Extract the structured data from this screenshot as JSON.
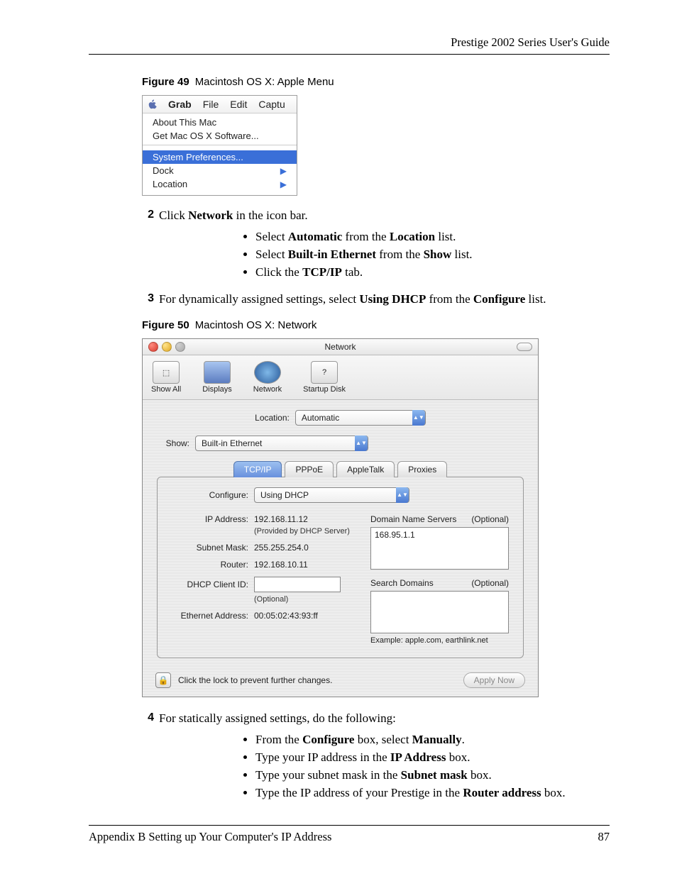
{
  "header": {
    "guide_title": "Prestige 2002 Series User's Guide"
  },
  "fig49": {
    "caption_num": "Figure 49",
    "caption_text": "Macintosh OS X: Apple Menu",
    "menubar": {
      "app": "Grab",
      "file": "File",
      "edit": "Edit",
      "capture": "Captu"
    },
    "items": {
      "about": "About This Mac",
      "software": "Get Mac OS X Software...",
      "sysprefs": "System Preferences...",
      "dock": "Dock",
      "location": "Location"
    }
  },
  "step2": {
    "num": "2",
    "text_a": "Click ",
    "text_b": "Network",
    "text_c": " in the icon bar.",
    "bullets": [
      {
        "pre": "Select ",
        "b1": "Automatic",
        "mid": " from the ",
        "b2": "Location",
        "post": " list."
      },
      {
        "pre": "Select ",
        "b1": "Built-in Ethernet",
        "mid": " from the ",
        "b2": "Show",
        "post": " list."
      },
      {
        "pre": "Click the ",
        "b1": "TCP/IP",
        "mid": "",
        "b2": "",
        "post": " tab."
      }
    ]
  },
  "step3": {
    "num": "3",
    "text_a": "For dynamically assigned settings, select ",
    "text_b": "Using DHCP",
    "text_c": " from the ",
    "text_d": "Configure",
    "text_e": " list."
  },
  "fig50": {
    "caption_num": "Figure 50",
    "caption_text": "Macintosh OS X: Network",
    "title": "Network",
    "toolbar": {
      "showall": "Show All",
      "displays": "Displays",
      "network": "Network",
      "startup": "Startup Disk"
    },
    "location_label": "Location:",
    "location_value": "Automatic",
    "show_label": "Show:",
    "show_value": "Built-in Ethernet",
    "tabs": {
      "tcpip": "TCP/IP",
      "pppoe": "PPPoE",
      "appletalk": "AppleTalk",
      "proxies": "Proxies"
    },
    "configure_label": "Configure:",
    "configure_value": "Using DHCP",
    "left": {
      "ip_label": "IP Address:",
      "ip_value": "192.168.11.12",
      "ip_note": "(Provided by DHCP Server)",
      "subnet_label": "Subnet Mask:",
      "subnet_value": "255.255.254.0",
      "router_label": "Router:",
      "router_value": "192.168.10.11",
      "dhcpid_label": "DHCP Client ID:",
      "dhcpid_note": "(Optional)",
      "eth_label": "Ethernet Address:",
      "eth_value": "00:05:02:43:93:ff"
    },
    "right": {
      "dns_label": "Domain Name Servers",
      "optional": "(Optional)",
      "dns_value": "168.95.1.1",
      "search_label": "Search Domains",
      "example": "Example: apple.com, earthlink.net"
    },
    "lock_text": "Click the lock to prevent further changes.",
    "apply": "Apply Now"
  },
  "step4": {
    "num": "4",
    "text": "For statically assigned settings, do the following:",
    "bullets": [
      {
        "pre": "From the ",
        "b1": "Configure",
        "mid": " box, select ",
        "b2": "Manually",
        "post": "."
      },
      {
        "pre": "Type your IP address in the ",
        "b1": "IP Address",
        "mid": "",
        "b2": "",
        "post": " box."
      },
      {
        "pre": "Type your subnet mask in the ",
        "b1": "Subnet mask",
        "mid": "",
        "b2": "",
        "post": " box."
      },
      {
        "pre": "Type the IP address of your Prestige in the ",
        "b1": "Router address",
        "mid": "",
        "b2": "",
        "post": " box."
      }
    ]
  },
  "footer": {
    "appendix": "Appendix B Setting up Your Computer's IP Address",
    "page": "87"
  }
}
